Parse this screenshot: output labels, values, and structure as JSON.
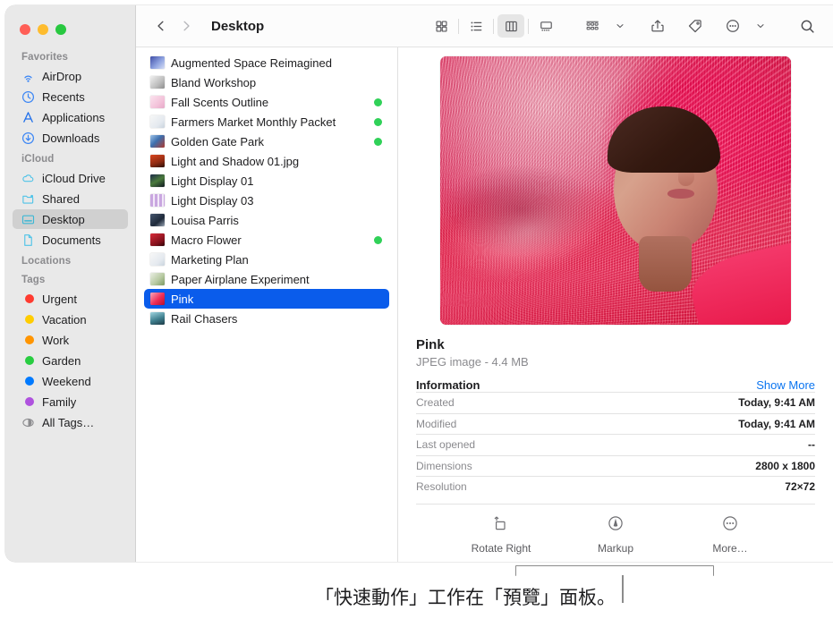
{
  "window": {
    "traffic_lights": [
      {
        "name": "close",
        "color": "#ff5f57"
      },
      {
        "name": "minimize",
        "color": "#febc2e"
      },
      {
        "name": "zoom",
        "color": "#28c840"
      }
    ]
  },
  "sidebar": {
    "sections": [
      {
        "header": "Favorites",
        "items": [
          {
            "label": "AirDrop",
            "icon": "airdrop-icon"
          },
          {
            "label": "Recents",
            "icon": "clock-icon"
          },
          {
            "label": "Applications",
            "icon": "applications-icon"
          },
          {
            "label": "Downloads",
            "icon": "downloads-icon"
          }
        ]
      },
      {
        "header": "iCloud",
        "items": [
          {
            "label": "iCloud Drive",
            "icon": "cloud-icon"
          },
          {
            "label": "Shared",
            "icon": "shared-folder-icon"
          },
          {
            "label": "Desktop",
            "icon": "desktop-icon",
            "selected": true
          },
          {
            "label": "Documents",
            "icon": "document-icon"
          }
        ]
      },
      {
        "header": "Locations",
        "items": []
      },
      {
        "header": "Tags",
        "items": [
          {
            "label": "Urgent",
            "icon": "tag-dot",
            "color": "#ff3b30"
          },
          {
            "label": "Vacation",
            "icon": "tag-dot",
            "color": "#ffcc00"
          },
          {
            "label": "Work",
            "icon": "tag-dot",
            "color": "#ff9500"
          },
          {
            "label": "Garden",
            "icon": "tag-dot",
            "color": "#28cd41"
          },
          {
            "label": "Weekend",
            "icon": "tag-dot",
            "color": "#007aff"
          },
          {
            "label": "Family",
            "icon": "tag-dot",
            "color": "#af52de"
          },
          {
            "label": "All Tags…",
            "icon": "all-tags-icon"
          }
        ]
      }
    ]
  },
  "toolbar": {
    "back_label": "Back",
    "forward_label": "Forward",
    "title": "Desktop",
    "views": [
      {
        "name": "icon-view",
        "active": false
      },
      {
        "name": "list-view",
        "active": false
      },
      {
        "name": "column-view",
        "active": true
      },
      {
        "name": "gallery-view",
        "active": false
      }
    ],
    "group_by_label": "Group By",
    "share_label": "Share",
    "tags_label": "Tags",
    "more_label": "More",
    "search_label": "Search"
  },
  "filelist": {
    "items": [
      {
        "name": "Augmented Space Reimagined",
        "tag": null,
        "icon": "image-thumb-blue",
        "selected": false
      },
      {
        "name": "Bland Workshop",
        "tag": null,
        "icon": "image-thumb-gray",
        "selected": false
      },
      {
        "name": "Fall Scents Outline",
        "tag": "#30d158",
        "icon": "image-thumb-pink",
        "selected": false
      },
      {
        "name": "Farmers Market Monthly Packet",
        "tag": "#30d158",
        "icon": "document-thumb",
        "selected": false
      },
      {
        "name": "Golden Gate Park",
        "tag": "#30d158",
        "icon": "image-thumb-red",
        "selected": false
      },
      {
        "name": "Light and Shadow 01.jpg",
        "tag": null,
        "icon": "image-thumb-orange",
        "selected": false
      },
      {
        "name": "Light Display 01",
        "tag": null,
        "icon": "image-thumb-dark",
        "selected": false
      },
      {
        "name": "Light Display 03",
        "tag": null,
        "icon": "image-thumb-violet",
        "selected": false
      },
      {
        "name": "Louisa Parris",
        "tag": null,
        "icon": "image-thumb-navy",
        "selected": false
      },
      {
        "name": "Macro Flower",
        "tag": "#30d158",
        "icon": "image-thumb-crimson",
        "selected": false
      },
      {
        "name": "Marketing Plan",
        "tag": null,
        "icon": "document-thumb",
        "selected": false
      },
      {
        "name": "Paper Airplane Experiment",
        "tag": null,
        "icon": "image-thumb-sage",
        "selected": false
      },
      {
        "name": "Pink",
        "tag": null,
        "icon": "image-thumb-pinkred",
        "selected": true
      },
      {
        "name": "Rail Chasers",
        "tag": null,
        "icon": "image-thumb-teal",
        "selected": false
      }
    ]
  },
  "preview": {
    "file_name": "Pink",
    "file_subtitle": "JPEG image - 4.4 MB",
    "information_title": "Information",
    "show_more_label": "Show More",
    "rows": [
      {
        "key": "Created",
        "value": "Today, 9:41 AM"
      },
      {
        "key": "Modified",
        "value": "Today, 9:41 AM"
      },
      {
        "key": "Last opened",
        "value": "--"
      },
      {
        "key": "Dimensions",
        "value": "2800 x 1800"
      },
      {
        "key": "Resolution",
        "value": "72×72"
      }
    ],
    "quick_actions": [
      {
        "label": "Rotate Right",
        "icon": "rotate-right-icon"
      },
      {
        "label": "Markup",
        "icon": "markup-icon"
      },
      {
        "label": "More…",
        "icon": "more-circle-icon"
      }
    ]
  },
  "callout": {
    "caption": "「快速動作」工作在「預覽」面板。",
    "line_color": "#8c8c8c"
  }
}
